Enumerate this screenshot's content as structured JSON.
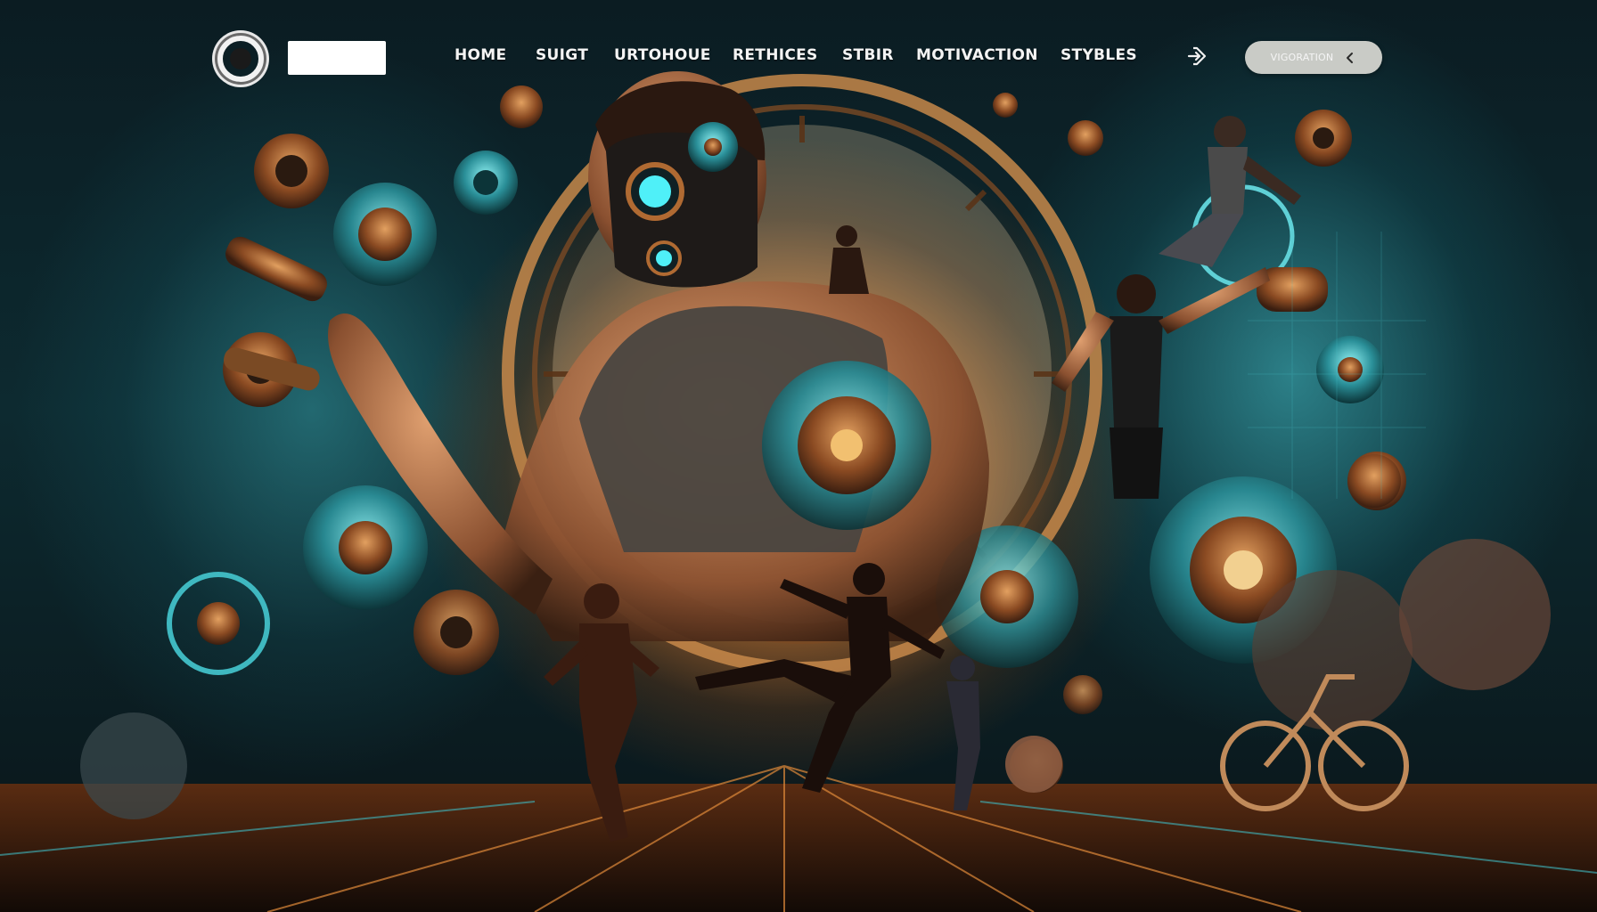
{
  "nav": {
    "items": [
      {
        "label": "HOME"
      },
      {
        "label": "SUIGT"
      },
      {
        "label": "URTOHOUE"
      },
      {
        "label": "RETHICES"
      },
      {
        "label": "STBIR"
      },
      {
        "label": "MOTIVACTION"
      },
      {
        "label": "STYBLES"
      }
    ],
    "login_icon": "arrow-right-icon",
    "cta": {
      "label": "VIGORATION",
      "icon": "chevron-left-icon"
    }
  },
  "hero": {
    "theme": "steampunk fitness illustration",
    "colors": {
      "glow": "#f6b86a",
      "teal": "#2fb4bc",
      "dark": "#0a1418",
      "copper": "#b06a32"
    }
  }
}
